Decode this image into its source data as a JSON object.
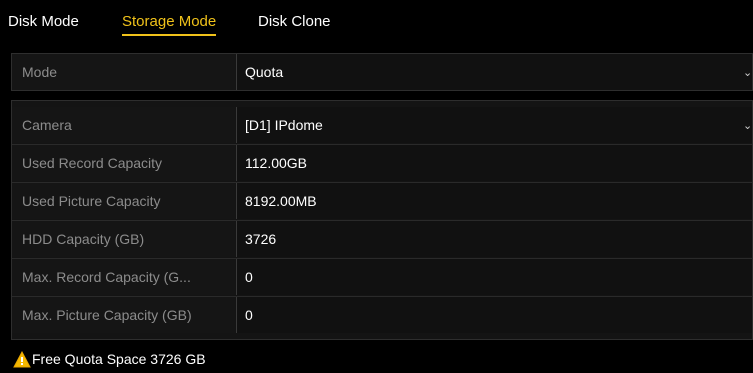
{
  "tabs": [
    {
      "label": "Disk Mode",
      "active": false
    },
    {
      "label": "Storage Mode",
      "active": true
    },
    {
      "label": "Disk Clone",
      "active": false
    }
  ],
  "mode": {
    "label": "Mode",
    "value": "Quota"
  },
  "quota": {
    "camera": {
      "label": "Camera",
      "value": "[D1] IPdome"
    },
    "used_record": {
      "label": "Used Record Capacity",
      "value": "112.00GB"
    },
    "used_picture": {
      "label": "Used Picture Capacity",
      "value": "8192.00MB"
    },
    "hdd_capacity": {
      "label": "HDD Capacity (GB)",
      "value": "3726"
    },
    "max_record": {
      "label": "Max. Record Capacity (G...",
      "value": "0"
    },
    "max_picture": {
      "label": "Max. Picture Capacity (GB)",
      "value": "0"
    }
  },
  "warning": {
    "text": "Free Quota Space 3726 GB",
    "icon": "warning-icon"
  },
  "colors": {
    "accent": "#f0c21a",
    "background": "#000000",
    "label_text": "#8c8c8c",
    "value_text": "#ffffff"
  }
}
